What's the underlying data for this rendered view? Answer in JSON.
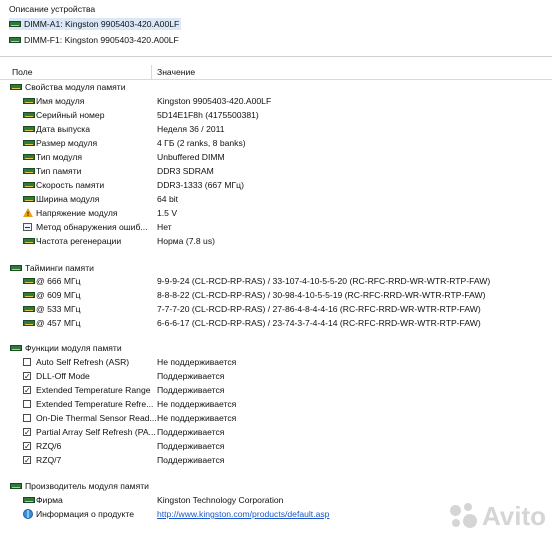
{
  "device_panel": {
    "title": "Описание устройства",
    "items": [
      {
        "label": "DIMM-A1: Kingston 9905403-420.A00LF",
        "selected": true
      },
      {
        "label": "DIMM-F1: Kingston 9905403-420.A00LF",
        "selected": false
      }
    ]
  },
  "columns": {
    "field": "Поле",
    "value": "Значение"
  },
  "sections": {
    "module": {
      "title": "Свойства модуля памяти",
      "rows": [
        {
          "label": "Имя модуля",
          "value": "Kingston 9905403-420.A00LF"
        },
        {
          "label": "Серийный номер",
          "value": "5D14E1F8h (4175500381)"
        },
        {
          "label": "Дата выпуска",
          "value": "Неделя 36 / 2011"
        },
        {
          "label": "Размер модуля",
          "value": "4 ГБ (2 ranks, 8 banks)"
        },
        {
          "label": "Тип модуля",
          "value": "Unbuffered DIMM"
        },
        {
          "label": "Тип памяти",
          "value": "DDR3 SDRAM"
        },
        {
          "label": "Скорость памяти",
          "value": "DDR3-1333 (667 МГц)"
        },
        {
          "label": "Ширина модуля",
          "value": "64 bit"
        },
        {
          "label": "Напряжение модуля",
          "value": "1.5 V"
        },
        {
          "label": "Метод обнаружения ошиб...",
          "value": "Нет"
        },
        {
          "label": "Частота регенерации",
          "value": "Норма (7.8 us)"
        }
      ]
    },
    "timings": {
      "title": "Тайминги памяти",
      "rows": [
        {
          "label": "@ 666 МГц",
          "value": "9-9-9-24  (CL-RCD-RP-RAS) / 33-107-4-10-5-5-20  (RC-RFC-RRD-WR-WTR-RTP-FAW)"
        },
        {
          "label": "@ 609 МГц",
          "value": "8-8-8-22  (CL-RCD-RP-RAS) / 30-98-4-10-5-5-19  (RC-RFC-RRD-WR-WTR-RTP-FAW)"
        },
        {
          "label": "@ 533 МГц",
          "value": "7-7-7-20  (CL-RCD-RP-RAS) / 27-86-4-8-4-4-16  (RC-RFC-RRD-WR-WTR-RTP-FAW)"
        },
        {
          "label": "@ 457 МГц",
          "value": "6-6-6-17  (CL-RCD-RP-RAS) / 23-74-3-7-4-4-14  (RC-RFC-RRD-WR-WTR-RTP-FAW)"
        }
      ]
    },
    "features": {
      "title": "Функции модуля памяти",
      "rows": [
        {
          "label": "Auto Self Refresh (ASR)",
          "value": "Не поддерживается",
          "checked": false
        },
        {
          "label": "DLL-Off Mode",
          "value": "Поддерживается",
          "checked": true
        },
        {
          "label": "Extended Temperature Range",
          "value": "Поддерживается",
          "checked": true
        },
        {
          "label": "Extended Temperature Refre...",
          "value": "Не поддерживается",
          "checked": false
        },
        {
          "label": "On-Die Thermal Sensor Read...",
          "value": "Не поддерживается",
          "checked": false
        },
        {
          "label": "Partial Array Self Refresh (PA...",
          "value": "Поддерживается",
          "checked": true
        },
        {
          "label": "RZQ/6",
          "value": "Поддерживается",
          "checked": true
        },
        {
          "label": "RZQ/7",
          "value": "Поддерживается",
          "checked": true
        }
      ]
    },
    "manufacturer": {
      "title": "Производитель модуля памяти",
      "rows": [
        {
          "label": "Фирма",
          "value": "Kingston Technology Corporation"
        },
        {
          "label": "Информация о продукте",
          "value": "http://www.kingston.com/products/default.asp"
        }
      ]
    }
  },
  "watermark": {
    "text": "Avito"
  }
}
